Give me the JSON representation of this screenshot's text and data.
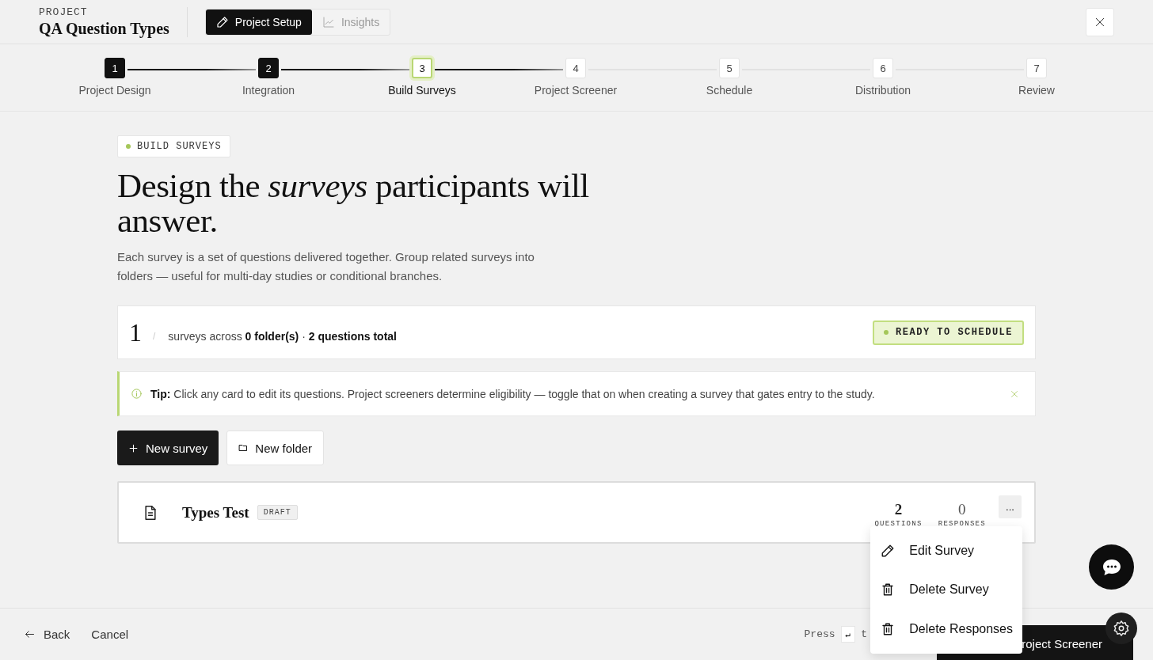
{
  "header": {
    "eyebrow": "PROJECT",
    "title": "QA Question Types",
    "tabs": [
      {
        "label": "Project Setup",
        "kind": "setup",
        "selected": true,
        "disabled": false
      },
      {
        "label": "Insights",
        "kind": "insights",
        "selected": false,
        "disabled": true
      }
    ]
  },
  "steps": [
    {
      "number": "1",
      "label": "Project Design",
      "done": true,
      "selected": false
    },
    {
      "number": "2",
      "label": "Integration",
      "done": true,
      "selected": false
    },
    {
      "number": "3",
      "label": "Build Surveys",
      "done": false,
      "selected": true
    },
    {
      "number": "4",
      "label": "Project Screener",
      "done": false,
      "selected": false
    },
    {
      "number": "5",
      "label": "Schedule",
      "done": false,
      "selected": false
    },
    {
      "number": "6",
      "label": "Distribution",
      "done": false,
      "selected": false
    },
    {
      "number": "7",
      "label": "Review",
      "done": false,
      "selected": false
    }
  ],
  "intro": {
    "badge": "BUILD SURVEYS",
    "heading": "Design the *surveys* participants will answer.",
    "description": "Each survey is a set of questions delivered together. Group related surveys into folders — useful for multi-day studies or conditional branches."
  },
  "summary": {
    "count": "1",
    "separator": "/",
    "text": "surveys across **0 folder(s)** · **2 questions total**",
    "status": "READY TO SCHEDULE"
  },
  "tip": {
    "text": "**Tip:** Click any card to edit its questions. Project screeners determine eligibility — toggle that on when creating a survey that gates entry to the study."
  },
  "actions": [
    {
      "label": "New survey",
      "kind": "primary"
    },
    {
      "label": "New folder",
      "kind": "secondary"
    }
  ],
  "surveys": [
    {
      "title": "Types Test",
      "badge": "DRAFT",
      "stats": [
        {
          "value": "2",
          "label": "QUESTIONS"
        },
        {
          "value": "0",
          "label": "RESPONSES"
        }
      ],
      "menu_open": true,
      "more": "...",
      "menu": [
        {
          "label": "Edit Survey",
          "kind": "edit"
        },
        {
          "label": "Delete Survey",
          "kind": "delete"
        },
        {
          "label": "Delete Responses",
          "kind": "delete"
        }
      ]
    }
  ],
  "footer": {
    "back": "Back",
    "cancel": "Cancel",
    "hint": "Press",
    "key": "↵",
    "hint_end": "t",
    "next": "roject Screener"
  }
}
